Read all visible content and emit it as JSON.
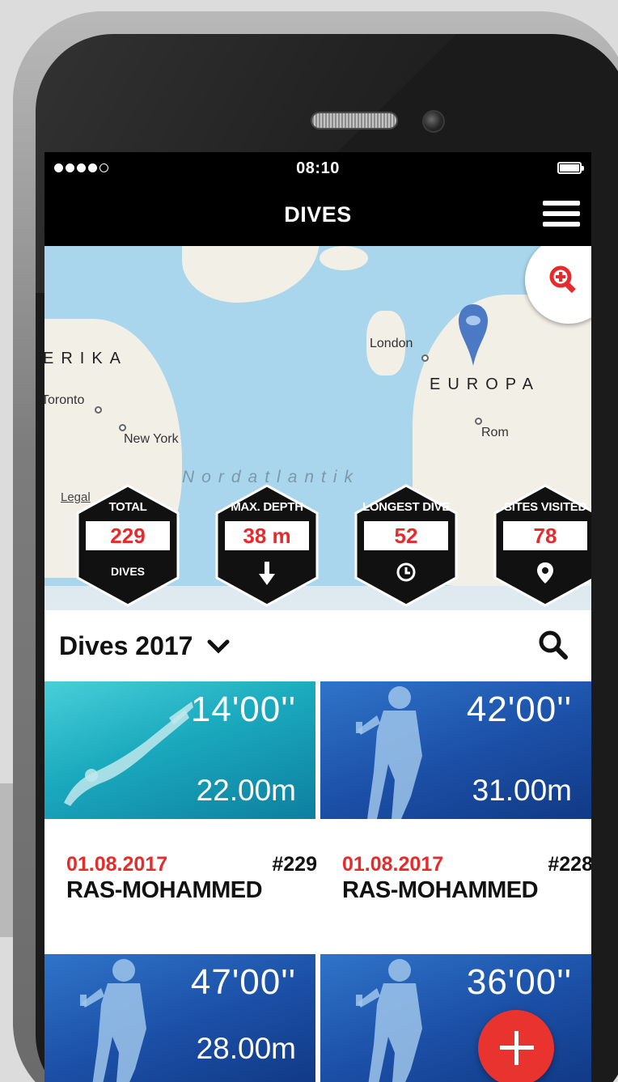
{
  "status_bar": {
    "time": "08:10"
  },
  "nav": {
    "title": "DIVES"
  },
  "map": {
    "continent_left": "ERIKA",
    "continent_right": "EUROPA",
    "ocean": "Nordatlantik",
    "cities": [
      "London",
      "Toronto",
      "New York",
      "Rom"
    ],
    "legal_link": "Legal"
  },
  "stats": [
    {
      "label": "TOTAL",
      "value": "229",
      "sub": "DIVES",
      "icon": "none"
    },
    {
      "label": "MAX. DEPTH",
      "value": "38 m",
      "sub": "",
      "icon": "arrow-down-icon"
    },
    {
      "label": "LONGEST DIVE",
      "value": "52",
      "sub": "",
      "icon": "clock-icon"
    },
    {
      "label": "SITES VISITED",
      "value": "78",
      "sub": "",
      "icon": "location-pin-icon"
    }
  ],
  "list_header": {
    "filter_label": "Dives 2017"
  },
  "dives": [
    {
      "duration": "14'00''",
      "depth": "22.00m",
      "date": "01.08.2017",
      "number": "#229",
      "site": "RAS-MOHAMMED"
    },
    {
      "duration": "42'00''",
      "depth": "31.00m",
      "date": "01.08.2017",
      "number": "#228",
      "site": "RAS-MOHAMMED"
    },
    {
      "duration": "47'00''",
      "depth": "28.00m",
      "date": "",
      "number": "",
      "site": ""
    },
    {
      "duration": "36'00''",
      "depth": "",
      "date": "",
      "number": "",
      "site": ""
    }
  ],
  "colors": {
    "accent_red": "#e52b2b",
    "header_black": "#000000",
    "map_water": "#a9d6ec"
  }
}
